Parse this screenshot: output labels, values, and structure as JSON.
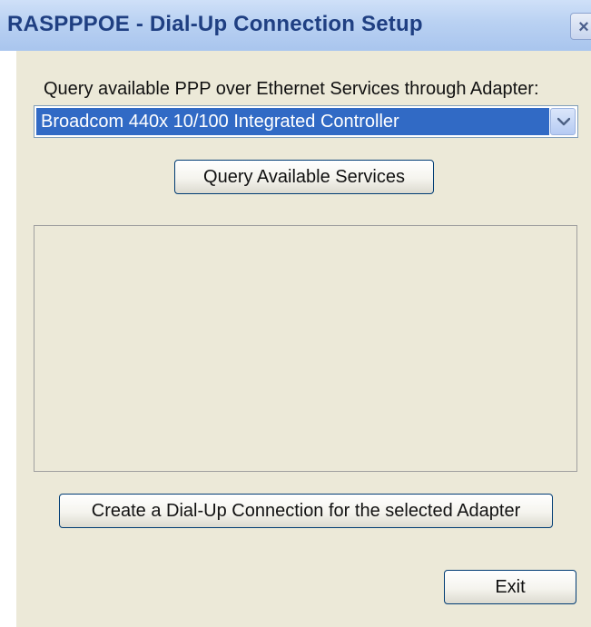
{
  "window": {
    "title": "RASPPPOE - Dial-Up Connection Setup",
    "close_symbol": "×"
  },
  "adapter": {
    "label": "Query available PPP over Ethernet Services through Adapter:",
    "selected": "Broadcom 440x 10/100 Integrated Controller",
    "dropdown_icon": "chevron-down-icon"
  },
  "buttons": {
    "query": "Query Available Services",
    "create": "Create a Dial-Up Connection for the selected Adapter",
    "exit": "Exit"
  },
  "services": {
    "items": []
  },
  "colors": {
    "title_text": "#1f3f82",
    "selection": "#316ac5",
    "dialog_bg": "#ece9d8"
  }
}
